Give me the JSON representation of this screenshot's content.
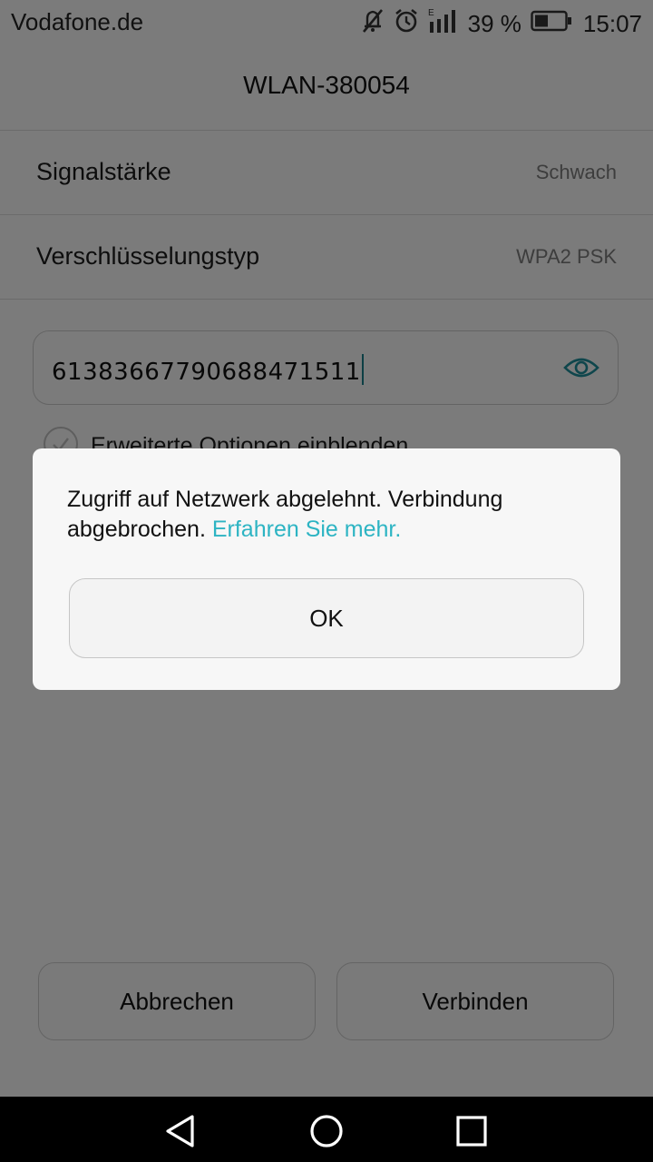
{
  "status_bar": {
    "carrier": "Vodafone.de",
    "network_type": "E",
    "battery_percent": "39 %",
    "time": "15:07",
    "icons": [
      "mute-icon",
      "alarm-icon",
      "signal-icon",
      "battery-icon"
    ]
  },
  "wifi_details": {
    "network_name": "WLAN-380054",
    "rows": [
      {
        "label": "Signalstärke",
        "value": "Schwach"
      },
      {
        "label": "Verschlüsselungstyp",
        "value": "WPA2 PSK"
      }
    ],
    "password_value": "61383667790688471511",
    "show_password_icon": "eye-icon",
    "advanced_options_label": "Erweiterte Optionen einblenden"
  },
  "buttons": {
    "cancel_label": "Abbrechen",
    "connect_label": "Verbinden"
  },
  "dialog": {
    "message": "Zugriff auf Netzwerk abgelehnt. Verbindung abgebrochen.",
    "link_text": "Erfahren Sie mehr.",
    "ok_label": "OK"
  },
  "colors": {
    "accent": "#2db4c3",
    "scrim": "rgba(0,0,0,0.5)"
  },
  "navigation": {
    "icons": [
      "back-icon",
      "home-icon",
      "recents-icon"
    ]
  }
}
